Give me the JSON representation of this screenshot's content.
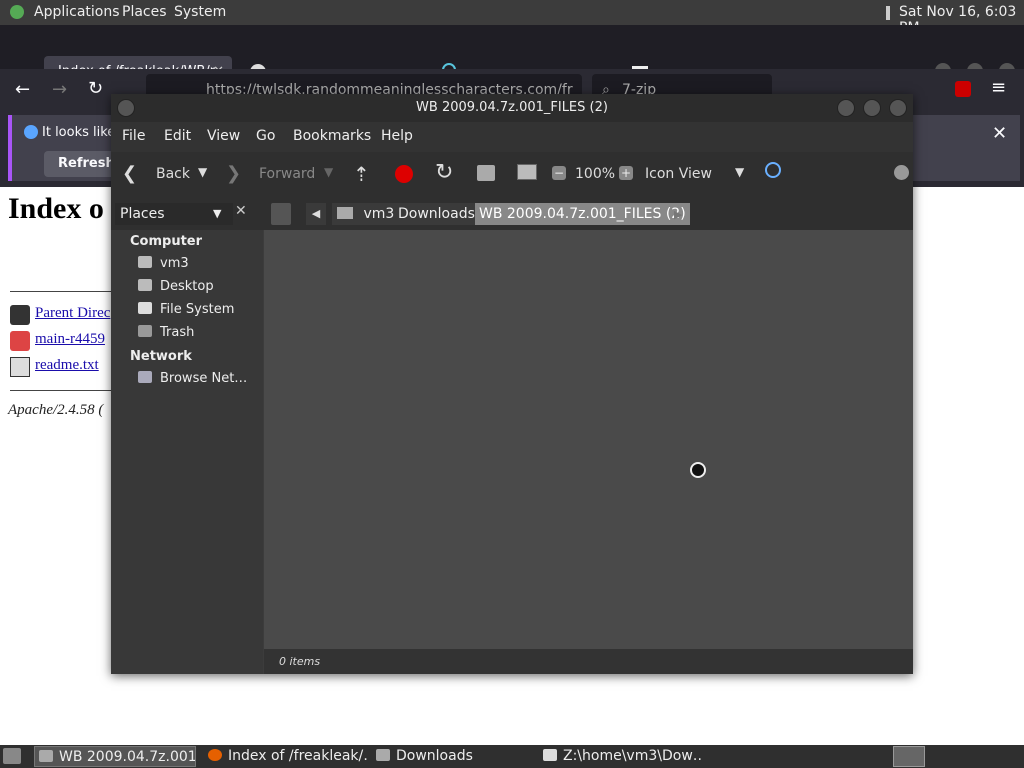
{
  "top_panel": {
    "menus": [
      "Applications",
      "Places",
      "System"
    ],
    "clock": "Sat Nov 16,  6:03 PM"
  },
  "browser": {
    "tab_active": "Index of /freakleak/WB/r",
    "url": "https://twlsdk.randommeaninglesscharacters.com/fr",
    "search": "7-zip",
    "notification_text": "It looks like",
    "refresh_button": "Refresh F"
  },
  "webpage": {
    "heading": "Index o",
    "links": [
      "Parent Direc",
      "main-r4459",
      "readme.txt"
    ],
    "footer": "Apache/2.4.58 ("
  },
  "file_manager": {
    "title": "WB 2009.04.7z.001_FILES (2)",
    "menu": [
      "File",
      "Edit",
      "View",
      "Go",
      "Bookmarks",
      "Help"
    ],
    "toolbar": {
      "back": "Back",
      "forward": "Forward",
      "zoom": "100%",
      "view_mode": "Icon View"
    },
    "places_label": "Places",
    "breadcrumb": [
      "vm3",
      "Downloads",
      "WB 2009.04.7z.001_FILES (2)"
    ],
    "sidebar": {
      "computer_header": "Computer",
      "computer_items": [
        "vm3",
        "Desktop",
        "File System",
        "Trash"
      ],
      "network_header": "Network",
      "network_items": [
        "Browse Net…"
      ]
    },
    "status": "0 items"
  },
  "taskbar": {
    "tasks": [
      "WB 2009.04.7z.001…",
      "Index of /freakleak/…",
      "Downloads",
      "Z:\\home\\vm3\\Dow…"
    ]
  }
}
